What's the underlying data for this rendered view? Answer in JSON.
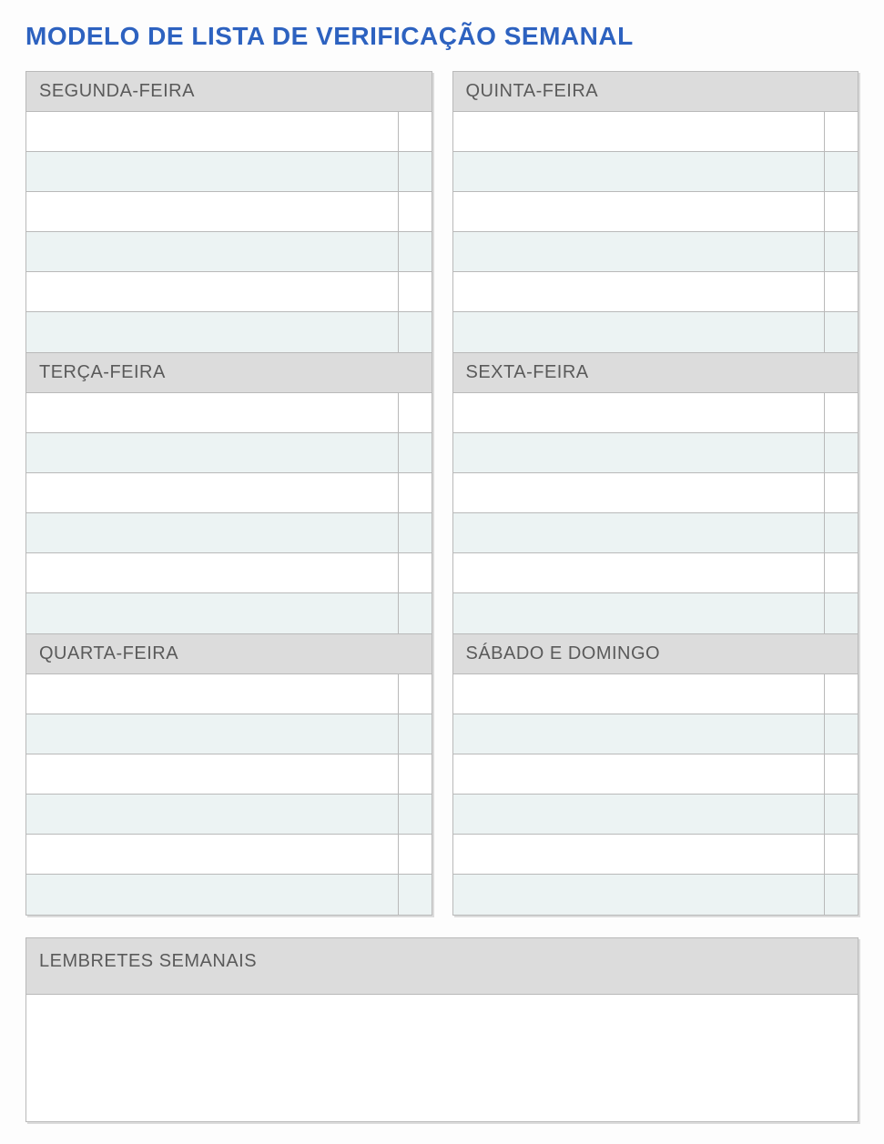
{
  "title": "MODELO DE LISTA DE VERIFICAÇÃO SEMANAL",
  "leftColumn": [
    {
      "label": "SEGUNDA-FEIRA",
      "rows": [
        "",
        "",
        "",
        "",
        "",
        ""
      ]
    },
    {
      "label": "TERÇA-FEIRA",
      "rows": [
        "",
        "",
        "",
        "",
        "",
        ""
      ]
    },
    {
      "label": "QUARTA-FEIRA",
      "rows": [
        "",
        "",
        "",
        "",
        "",
        ""
      ]
    }
  ],
  "rightColumn": [
    {
      "label": "QUINTA-FEIRA",
      "rows": [
        "",
        "",
        "",
        "",
        "",
        ""
      ]
    },
    {
      "label": "SEXTA-FEIRA",
      "rows": [
        "",
        "",
        "",
        "",
        "",
        ""
      ]
    },
    {
      "label": "SÁBADO E DOMINGO",
      "rows": [
        "",
        "",
        "",
        "",
        "",
        ""
      ]
    }
  ],
  "reminders": {
    "label": "LEMBRETES SEMANAIS",
    "content": ""
  }
}
